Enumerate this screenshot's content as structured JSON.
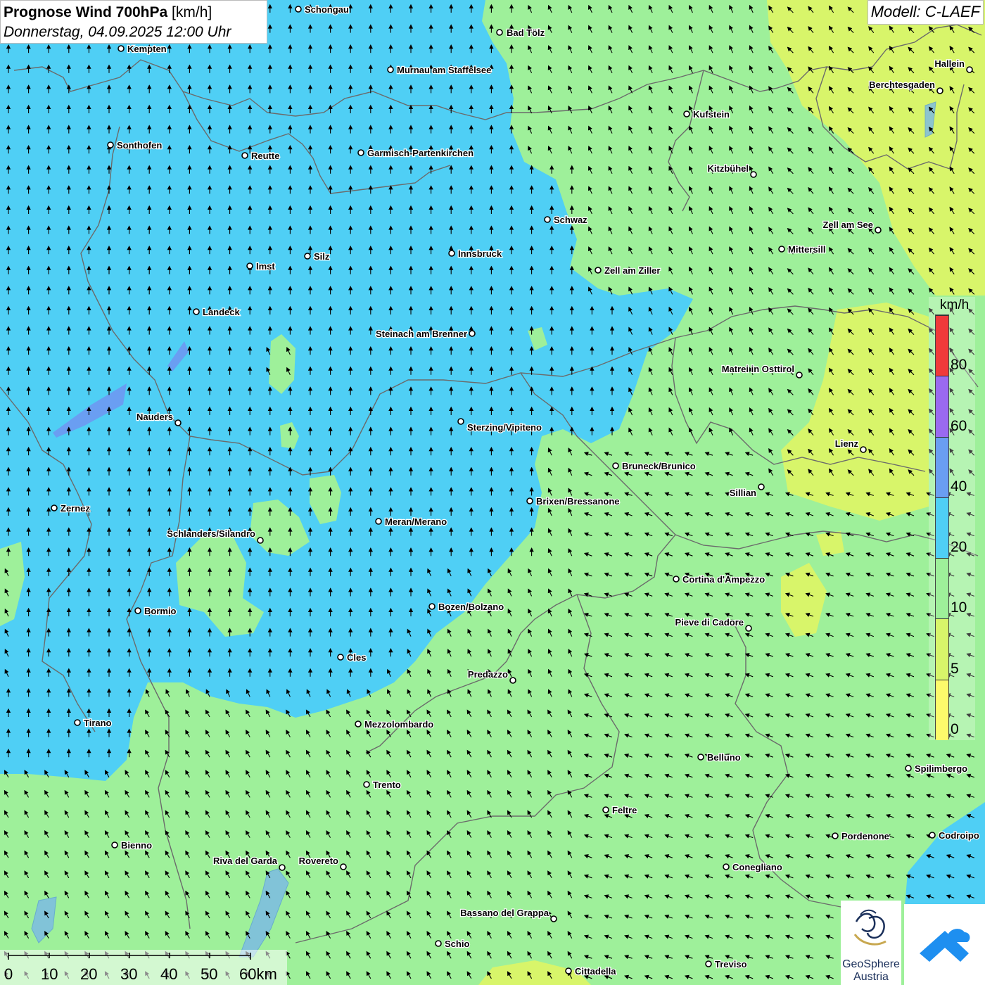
{
  "header": {
    "title_bold": "Prognose Wind 700hPa",
    "title_unit": "[km/h]",
    "subtitle": "Donnerstag, 04.09.2025 12:00 Uhr",
    "model": "Modell: C-LAEF"
  },
  "legend": {
    "unit": "km/h",
    "levels": [
      {
        "label": "0",
        "color": "#fdfa6b"
      },
      {
        "label": "5",
        "color": "#d8f56a"
      },
      {
        "label": "10",
        "color": "#9ef09a"
      },
      {
        "label": "20",
        "color": "#4fcff5"
      },
      {
        "label": "40",
        "color": "#6a9ef2"
      },
      {
        "label": "60",
        "color": "#9a6af0"
      },
      {
        "label": "80",
        "color": "#f03a3a"
      }
    ]
  },
  "scalebar": {
    "labels": [
      "0",
      "10",
      "20",
      "30",
      "40",
      "50",
      "60km"
    ]
  },
  "logos": {
    "geosphere_line1": "GeoSphere",
    "geosphere_line2": "Austria"
  },
  "cities": [
    {
      "name": "Schongau"
    },
    {
      "name": "Bad Tölz"
    },
    {
      "name": "Kempten"
    },
    {
      "name": "Murnau am Staffelsee"
    },
    {
      "name": "Hallein"
    },
    {
      "name": "Berchtesgaden"
    },
    {
      "name": "Kufstein"
    },
    {
      "name": "Sonthofen"
    },
    {
      "name": "Reutte"
    },
    {
      "name": "Garmisch-Partenkirchen"
    },
    {
      "name": "Kitzbühel"
    },
    {
      "name": "Schwaz"
    },
    {
      "name": "Zell am See"
    },
    {
      "name": "Mittersill"
    },
    {
      "name": "Innsbruck"
    },
    {
      "name": "Silz"
    },
    {
      "name": "Imst"
    },
    {
      "name": "Zell am Ziller"
    },
    {
      "name": "Landeck"
    },
    {
      "name": "Steinach am Brenner"
    },
    {
      "name": "Matrei in Osttirol"
    },
    {
      "name": "Nauders"
    },
    {
      "name": "Sterzing/Vipiteno"
    },
    {
      "name": "Lienz"
    },
    {
      "name": "Bruneck/Brunico"
    },
    {
      "name": "Sillian"
    },
    {
      "name": "Brixen/Bressanone"
    },
    {
      "name": "Zernez"
    },
    {
      "name": "Meran/Merano"
    },
    {
      "name": "Schlanders/Silandro"
    },
    {
      "name": "Cortina d'Ampezzo"
    },
    {
      "name": "Bozen/Bolzano"
    },
    {
      "name": "Bormio"
    },
    {
      "name": "Pieve di Cadore"
    },
    {
      "name": "Cles"
    },
    {
      "name": "Predazzo"
    },
    {
      "name": "Tirano"
    },
    {
      "name": "Mezzolombardo"
    },
    {
      "name": "Belluno"
    },
    {
      "name": "Spilimbergo"
    },
    {
      "name": "Trento"
    },
    {
      "name": "Feltre"
    },
    {
      "name": "Pordenone"
    },
    {
      "name": "Codroipo"
    },
    {
      "name": "Bienno"
    },
    {
      "name": "Riva del Garda"
    },
    {
      "name": "Rovereto"
    },
    {
      "name": "Conegliano"
    },
    {
      "name": "Bassano del Grappa"
    },
    {
      "name": "Schio"
    },
    {
      "name": "Treviso"
    },
    {
      "name": "Cittadella"
    }
  ]
}
